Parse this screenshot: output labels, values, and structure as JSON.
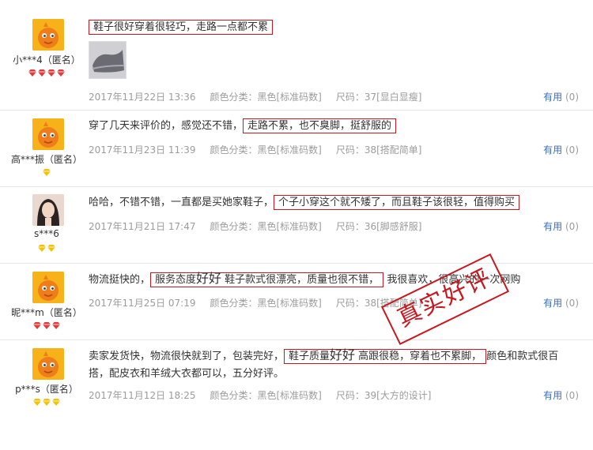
{
  "useful_label": "有用",
  "reviews": [
    {
      "nick": "小***4（匿名）",
      "text_before": "",
      "hl_a": "鞋子很好穿着很轻巧，走路一点都不累",
      "hl_big": "",
      "hl_b": "",
      "text_after": "",
      "date": "2017年11月22日 13:36",
      "color": "颜色分类：黑色[标准码数]",
      "size": "尺码：37[显白显瘦]",
      "useful_count": "(0)"
    },
    {
      "nick": "高***振（匿名）",
      "text_before": "穿了几天来评价的，感觉还不错，",
      "hl_a": "走路不累，也不臭脚，挺舒服的",
      "hl_big": "",
      "hl_b": "",
      "text_after": "",
      "date": "2017年11月23日 11:39",
      "color": "颜色分类：黑色[标准码数]",
      "size": "尺码：38[搭配简单]",
      "useful_count": "(0)"
    },
    {
      "nick": "s***6",
      "text_before": "哈哈，不错不错，一直都是买她家鞋子，",
      "hl_a": "个子小穿这个就不矮了，而且鞋子该很轻，值得购买",
      "hl_big": "",
      "hl_b": "",
      "text_after": "",
      "date": "2017年11月21日 17:47",
      "color": "颜色分类：黑色[标准码数]",
      "size": "尺码：36[脚感舒服]",
      "useful_count": "(0)"
    },
    {
      "nick": "昵***m（匿名）",
      "text_before": "物流挺快的，",
      "hl_a": "服务态度",
      "hl_big": "好好",
      "hl_b": " 鞋子款式很漂亮，质量也很不错，",
      "text_after": " 我很喜欢，很高兴的一次网购",
      "date": "2017年11月25日 07:19",
      "color": "颜色分类：黑色[标准码数]",
      "size": "尺码：38[搭配简单]",
      "useful_count": "(0)"
    },
    {
      "nick": "p***s（匿名）",
      "text_before": "卖家发货快，物流很快就到了，包装完好，",
      "hl_a": "鞋子质量",
      "hl_big": "好好",
      "hl_b": " 高跟很稳，穿着也不累脚，",
      "text_after": "颜色和款式很百搭，配皮衣和羊绒大衣都可以，五分好评。",
      "date": "2017年11月12日 18:25",
      "color": "颜色分类：黑色[标准码数]",
      "size": "尺码：39[大方的设计]",
      "useful_count": "(0)"
    }
  ],
  "stamp": "真实好评",
  "colors": {
    "highlight_border": "#c8171e",
    "meta_text": "#9c9c9c",
    "link": "#3c6fb8",
    "avatar": "#f7b21a"
  },
  "icons": {
    "badge_r1": "red-diamond-badge-icon",
    "badge_r2": "gold-diamond-badge-icon"
  }
}
